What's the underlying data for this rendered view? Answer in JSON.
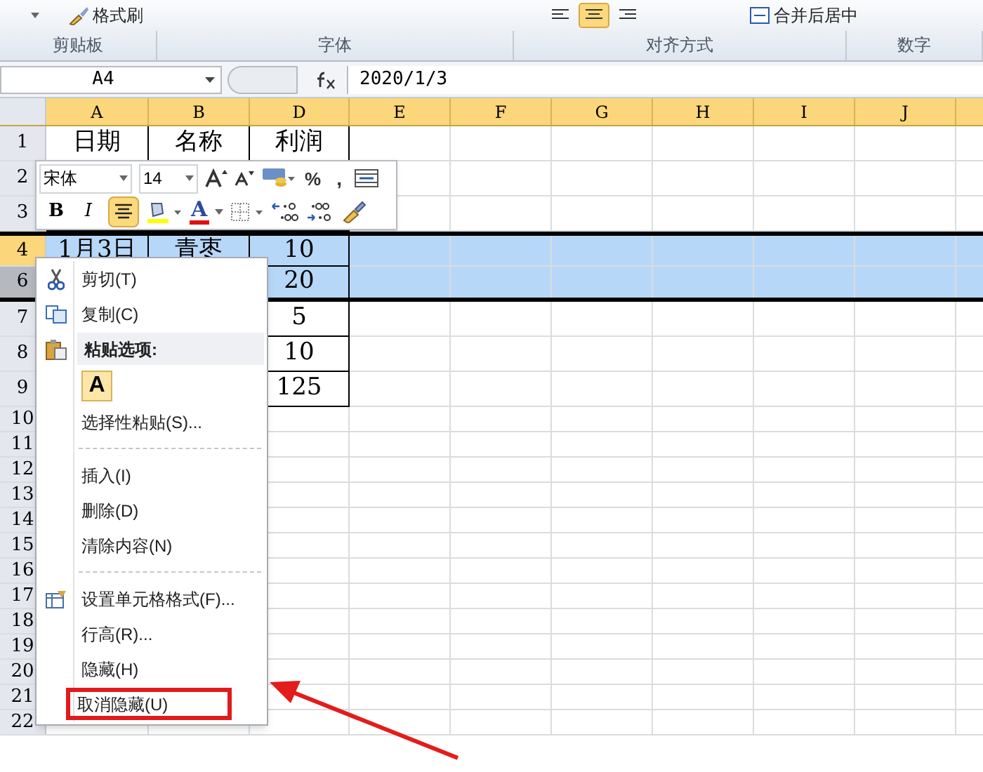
{
  "ribbon": {
    "top_items": [
      "格式刷",
      "合并后居中"
    ],
    "groups": [
      "剪贴板",
      "字体",
      "对齐方式",
      "数字"
    ]
  },
  "formula_bar": {
    "name_box": "A4",
    "value": "2020/1/3"
  },
  "columns": [
    "A",
    "B",
    "D",
    "E",
    "F",
    "G",
    "H",
    "I",
    "J"
  ],
  "rows": [
    {
      "label": "1",
      "selected": false,
      "cells": [
        "日期",
        "名称",
        "利润"
      ]
    },
    {
      "label": "2",
      "selected": false,
      "cells": []
    },
    {
      "label": "3",
      "selected": false,
      "cells": []
    },
    {
      "label": "4",
      "selected": true,
      "cells": [
        "1月3日",
        "青枣",
        "10"
      ]
    },
    {
      "label": "6",
      "selected": true,
      "cells": [
        "",
        "",
        "20"
      ]
    },
    {
      "label": "7",
      "selected": false,
      "cells": [
        "",
        "",
        "5"
      ]
    },
    {
      "label": "8",
      "selected": false,
      "cells": [
        "",
        "",
        "10"
      ]
    },
    {
      "label": "9",
      "selected": false,
      "cells": [
        "",
        "",
        "125"
      ]
    },
    {
      "label": "10",
      "selected": false,
      "cells": []
    },
    {
      "label": "11",
      "selected": false,
      "cells": []
    },
    {
      "label": "12",
      "selected": false,
      "cells": []
    },
    {
      "label": "13",
      "selected": false,
      "cells": []
    },
    {
      "label": "14",
      "selected": false,
      "cells": []
    },
    {
      "label": "15",
      "selected": false,
      "cells": []
    },
    {
      "label": "16",
      "selected": false,
      "cells": []
    },
    {
      "label": "17",
      "selected": false,
      "cells": []
    },
    {
      "label": "18",
      "selected": false,
      "cells": []
    },
    {
      "label": "19",
      "selected": false,
      "cells": []
    },
    {
      "label": "20",
      "selected": false,
      "cells": []
    },
    {
      "label": "21",
      "selected": false,
      "cells": []
    },
    {
      "label": "22",
      "selected": false,
      "cells": []
    }
  ],
  "mini_toolbar": {
    "font": "宋体",
    "size": "14",
    "percent": "%",
    "comma": ",",
    "bold": "B",
    "italic": "I",
    "font_color": "A",
    "align_center": true
  },
  "context_menu": {
    "items": [
      {
        "kind": "cut",
        "label": "剪切(T)",
        "highlighted": false
      },
      {
        "kind": "copy",
        "label": "复制(C)",
        "highlighted": false
      },
      {
        "kind": "header",
        "label": "粘贴选项:",
        "highlighted": false
      },
      {
        "kind": "paste",
        "label": "A",
        "highlighted": false
      },
      {
        "kind": "item",
        "label": "选择性粘贴(S)...",
        "highlighted": false
      },
      {
        "kind": "separator"
      },
      {
        "kind": "item",
        "label": "插入(I)",
        "highlighted": false
      },
      {
        "kind": "item",
        "label": "删除(D)",
        "highlighted": false
      },
      {
        "kind": "item",
        "label": "清除内容(N)",
        "highlighted": false
      },
      {
        "kind": "separator"
      },
      {
        "kind": "format",
        "label": "设置单元格格式(F)...",
        "highlighted": false
      },
      {
        "kind": "item",
        "label": "行高(R)...",
        "highlighted": false
      },
      {
        "kind": "item",
        "label": "隐藏(H)",
        "highlighted": false
      },
      {
        "kind": "item",
        "label": "取消隐藏(U)",
        "highlighted": true
      }
    ]
  }
}
